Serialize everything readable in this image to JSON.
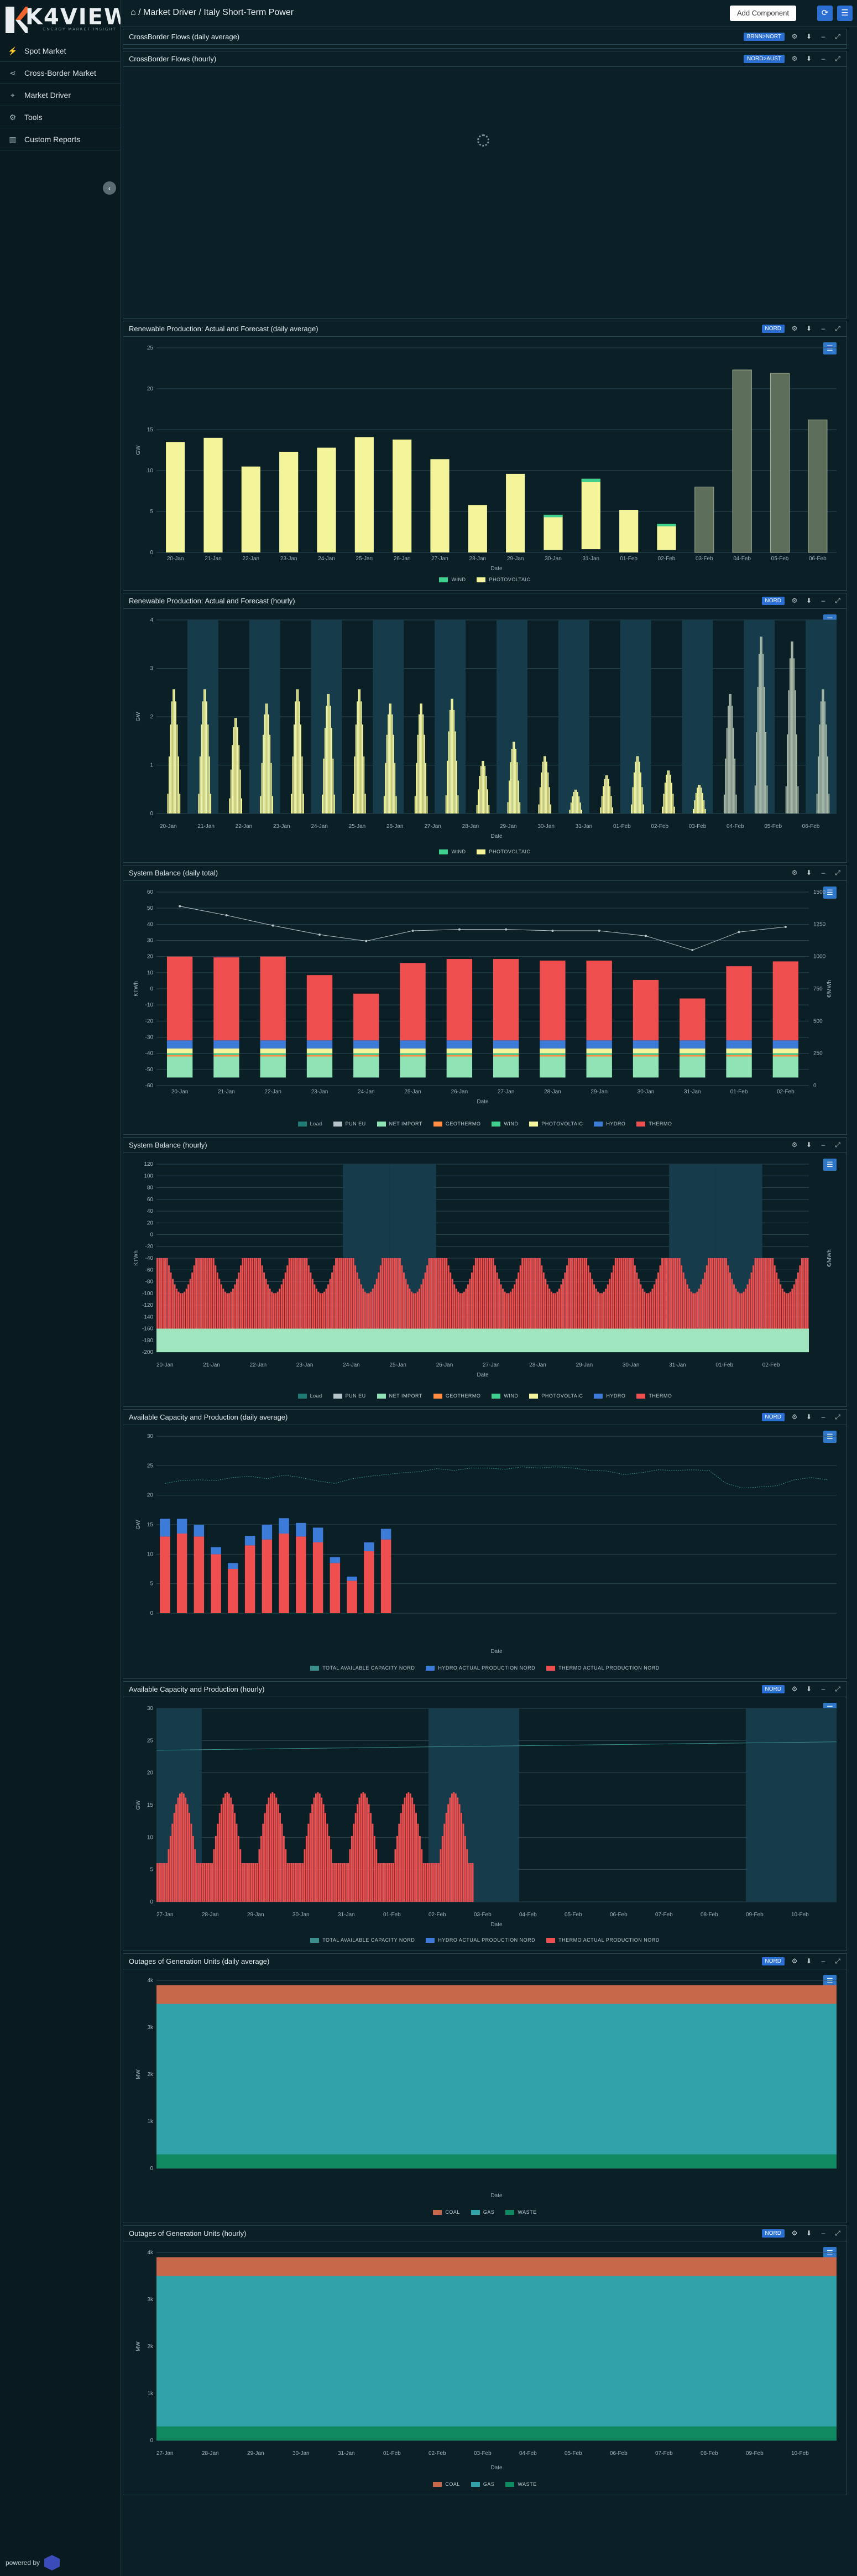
{
  "app": {
    "logo_text": "K4VIEW",
    "logo_sub": "ENERGY MARKET INSIGHT",
    "powered_by": "powered by"
  },
  "sidebar": {
    "items": [
      {
        "label": "Spot Market",
        "icon": "lightning-icon"
      },
      {
        "label": "Cross-Border Market",
        "icon": "share-icon"
      },
      {
        "label": "Market Driver",
        "icon": "tower-icon"
      },
      {
        "label": "Tools",
        "icon": "gear-icon"
      },
      {
        "label": "Custom Reports",
        "icon": "bar-chart-icon"
      }
    ]
  },
  "header": {
    "breadcrumb": "Market Driver / Italy Short-Term Power",
    "add_component": "Add Component"
  },
  "panels": [
    {
      "title": "CrossBorder Flows (daily average)",
      "selector": "BRNN>NORT"
    },
    {
      "title": "CrossBorder Flows (hourly)",
      "selector": "NORD>AUST"
    },
    {
      "title": "Renewable Production: Actual and Forecast (daily average)",
      "selector": "NORD"
    },
    {
      "title": "Renewable Production: Actual and Forecast (hourly)",
      "selector": "NORD"
    },
    {
      "title": "System Balance (daily total)",
      "selector": ""
    },
    {
      "title": "System Balance (hourly)",
      "selector": ""
    },
    {
      "title": "Available Capacity and Production (daily average)",
      "selector": "NORD"
    },
    {
      "title": "Available Capacity and Production (hourly)",
      "selector": "NORD"
    },
    {
      "title": "Outages of Generation Units (daily average)",
      "selector": "NORD"
    },
    {
      "title": "Outages of Generation Units (hourly)",
      "selector": "NORD"
    }
  ],
  "colors": {
    "wind": "#3fcf8e",
    "pv": "#f4f59a",
    "net_import": "#8fe3b5",
    "geothermo": "#ff8c42",
    "hydro": "#3d7bd9",
    "thermo": "#ef4f4f",
    "coal": "#c8684b",
    "gas": "#31a3a8",
    "waste": "#0f8a60",
    "load": "#1e7a73",
    "pun": "#b7c4c9"
  },
  "charts": {
    "ren_daily": {
      "ylabel": "GW",
      "xlabel": "Date",
      "categories": [
        "20-Jan",
        "21-Jan",
        "22-Jan",
        "23-Jan",
        "24-Jan",
        "25-Jan",
        "26-Jan",
        "27-Jan",
        "28-Jan",
        "29-Jan",
        "30-Jan",
        "31-Jan",
        "01-Feb",
        "02-Feb",
        "03-Feb",
        "04-Feb",
        "05-Feb",
        "06-Feb"
      ],
      "pv": [
        13.5,
        14,
        10.5,
        12.3,
        12.8,
        14.1,
        13.8,
        11.4,
        5.8,
        9.6,
        4.3,
        8.6,
        5.2,
        3.2,
        0,
        0,
        0,
        0
      ],
      "wind": [
        0,
        0,
        0,
        0,
        0,
        0,
        0,
        0,
        0,
        0,
        0.3,
        0.4,
        0,
        0.3,
        0,
        0,
        0,
        0
      ],
      "forecast": [
        0,
        0,
        0,
        0,
        0,
        0,
        0,
        0,
        0,
        0,
        0,
        0,
        0,
        0,
        8,
        22.3,
        21.9,
        16.2
      ],
      "yticks": [
        0,
        5,
        10,
        15,
        20,
        25
      ],
      "legend": [
        "WIND",
        "PHOTOVOLTAIC"
      ]
    },
    "ren_hourly": {
      "ylabel": "GW",
      "xlabel": "Date",
      "yticks": [
        0,
        1,
        2,
        3,
        4
      ],
      "legend": [
        "WIND",
        "PHOTOVOLTAIC"
      ],
      "peaks": [
        2.6,
        2.6,
        2,
        2.3,
        2.6,
        2.5,
        2.6,
        2.3,
        2.3,
        2.4,
        1.1,
        1.5,
        1.2,
        0.5,
        0.8,
        1.2,
        0.9,
        0.6,
        2.5,
        3.7,
        3.6,
        2.6
      ],
      "dates": [
        "20-Jan",
        "21-Jan",
        "22-Jan",
        "23-Jan",
        "24-Jan",
        "25-Jan",
        "26-Jan",
        "27-Jan",
        "28-Jan",
        "29-Jan",
        "30-Jan",
        "31-Jan",
        "01-Feb",
        "02-Feb",
        "03-Feb",
        "04-Feb",
        "05-Feb",
        "06-Feb"
      ]
    },
    "sb_daily": {
      "ylabel": "KTWh",
      "y2label": "€/MWh",
      "xlabel": "Date",
      "categories": [
        "20-Jan",
        "21-Jan",
        "22-Jan",
        "23-Jan",
        "24-Jan",
        "25-Jan",
        "26-Jan",
        "27-Jan",
        "28-Jan",
        "29-Jan",
        "30-Jan",
        "31-Jan",
        "01-Feb",
        "02-Feb"
      ],
      "thermo": [
        20,
        19.5,
        20,
        8.5,
        -3,
        16,
        18.5,
        18.5,
        17.5,
        17.5,
        5.5,
        -6,
        14,
        17
      ],
      "pun": [
        1390,
        1320,
        1240,
        1170,
        1120,
        1200,
        1210,
        1210,
        1200,
        1200,
        1160,
        1050,
        1190,
        1230
      ],
      "yticks": [
        -60,
        -50,
        -40,
        -30,
        -20,
        -10,
        0,
        10,
        20,
        30,
        40,
        50,
        60
      ],
      "y2ticks": [
        0,
        250,
        500,
        750,
        1000,
        1250,
        1500
      ],
      "legend": [
        "Load",
        "PUN EU",
        "NET IMPORT",
        "GEOTHERMO",
        "WIND",
        "PHOTOVOLTAIC",
        "HYDRO",
        "THERMO"
      ]
    },
    "sb_hourly": {
      "ylabel": "KTWh",
      "y2label": "€/MWh",
      "xlabel": "Date",
      "yticks": [
        -200,
        -180,
        -160,
        -140,
        -120,
        -100,
        -80,
        -60,
        -40,
        -20,
        0,
        20,
        40,
        60,
        80,
        100,
        120
      ],
      "y2ticks": [
        0,
        20,
        40,
        60,
        80
      ],
      "dates": [
        "20-Jan",
        "21-Jan",
        "22-Jan",
        "23-Jan",
        "24-Jan",
        "25-Jan",
        "26-Jan",
        "27-Jan",
        "28-Jan",
        "29-Jan",
        "30-Jan",
        "31-Jan",
        "01-Feb",
        "02-Feb"
      ],
      "legend": [
        "Load",
        "PUN EU",
        "NET IMPORT",
        "GEOTHERMO",
        "WIND",
        "PHOTOVOLTAIC",
        "HYDRO",
        "THERMO"
      ]
    },
    "cap_daily": {
      "ylabel": "GW",
      "xlabel": "Date",
      "thermo": [
        13,
        13.5,
        13,
        10,
        7.5,
        11.5,
        12.5,
        13.5,
        13,
        12,
        8.5,
        5.5,
        10.5,
        12.5
      ],
      "hydro": [
        3,
        2.5,
        2,
        1.2,
        1,
        1.6,
        2.5,
        2.6,
        2.3,
        2.5,
        1,
        0.7,
        1.5,
        1.8
      ],
      "capacity": [
        22,
        22.5,
        22.6,
        22.5,
        23,
        23.2,
        22.8,
        23.4,
        23,
        22.4,
        22,
        22.8,
        23.2,
        23.5,
        23.8,
        24,
        24.5,
        24.2,
        24.6,
        24.6,
        24.4,
        24.8,
        24.6,
        24.8,
        24.6,
        24.2,
        24.1,
        23.5,
        23.8,
        24.3,
        24.2,
        24.3,
        24.2,
        22,
        21.2,
        21.4,
        21.6,
        22.6,
        23,
        22.6
      ],
      "yticks": [
        0,
        5,
        10,
        15,
        20,
        25,
        30
      ],
      "legend": [
        "TOTAL AVAILABLE CAPACITY NORD",
        "HYDRO ACTUAL PRODUCTION NORD",
        "THERMO ACTUAL PRODUCTION NORD"
      ]
    },
    "cap_hourly": {
      "ylabel": "GW",
      "xlabel": "Date",
      "yticks": [
        0,
        5,
        10,
        15,
        20,
        25,
        30
      ],
      "dates": [
        "27-Jan",
        "28-Jan",
        "29-Jan",
        "30-Jan",
        "31-Jan",
        "01-Feb",
        "02-Feb",
        "03-Feb",
        "04-Feb",
        "05-Feb",
        "06-Feb",
        "07-Feb",
        "08-Feb",
        "09-Feb",
        "10-Feb"
      ],
      "legend": [
        "TOTAL AVAILABLE CAPACITY NORD",
        "HYDRO ACTUAL PRODUCTION NORD",
        "THERMO ACTUAL PRODUCTION NORD"
      ]
    },
    "out_daily": {
      "ylabel": "MW",
      "xlabel": "Date",
      "yticks": [
        "0",
        "1k",
        "2k",
        "3k",
        "4k"
      ],
      "legend": [
        "COAL",
        "GAS",
        "WASTE"
      ]
    },
    "out_hourly": {
      "ylabel": "MW",
      "xlabel": "Date",
      "yticks": [
        "0",
        "1k",
        "2k",
        "3k",
        "4k"
      ],
      "dates": [
        "27-Jan",
        "28-Jan",
        "29-Jan",
        "30-Jan",
        "31-Jan",
        "01-Feb",
        "02-Feb",
        "03-Feb",
        "04-Feb",
        "05-Feb",
        "06-Feb",
        "07-Feb",
        "08-Feb",
        "09-Feb",
        "10-Feb"
      ],
      "legend": [
        "COAL",
        "GAS",
        "WASTE"
      ]
    }
  }
}
